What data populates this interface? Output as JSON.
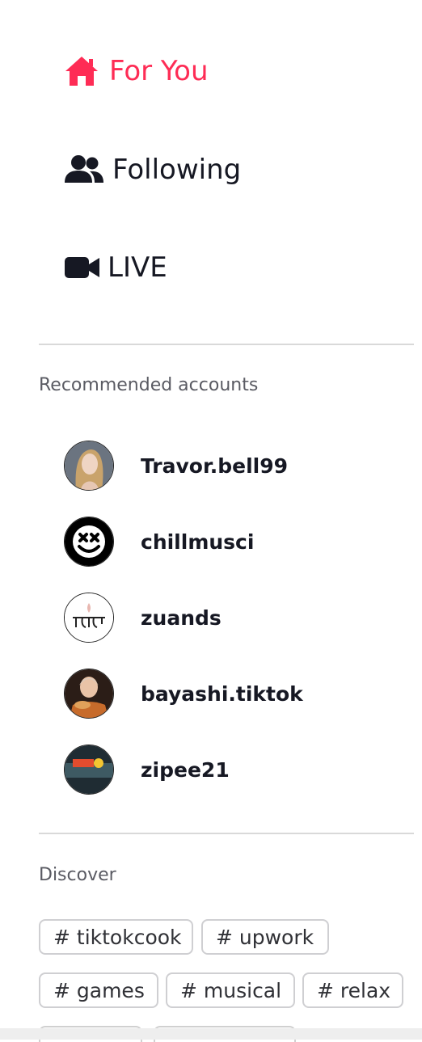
{
  "nav": {
    "for_you": "For You",
    "following": "Following",
    "live": "LIVE"
  },
  "colors": {
    "accent": "#fe2c55",
    "text": "#161823",
    "muted": "#5a5b63"
  },
  "recommended": {
    "title": "Recommended accounts",
    "accounts": [
      {
        "name": "Travor.bell99"
      },
      {
        "name": "chillmusci"
      },
      {
        "name": "zuands"
      },
      {
        "name": "bayashi.tiktok"
      },
      {
        "name": "zipee21"
      }
    ]
  },
  "discover": {
    "title": "Discover",
    "tags": [
      "# tiktokcook",
      "# upwork",
      "# games",
      "# musical",
      "# relax"
    ]
  }
}
